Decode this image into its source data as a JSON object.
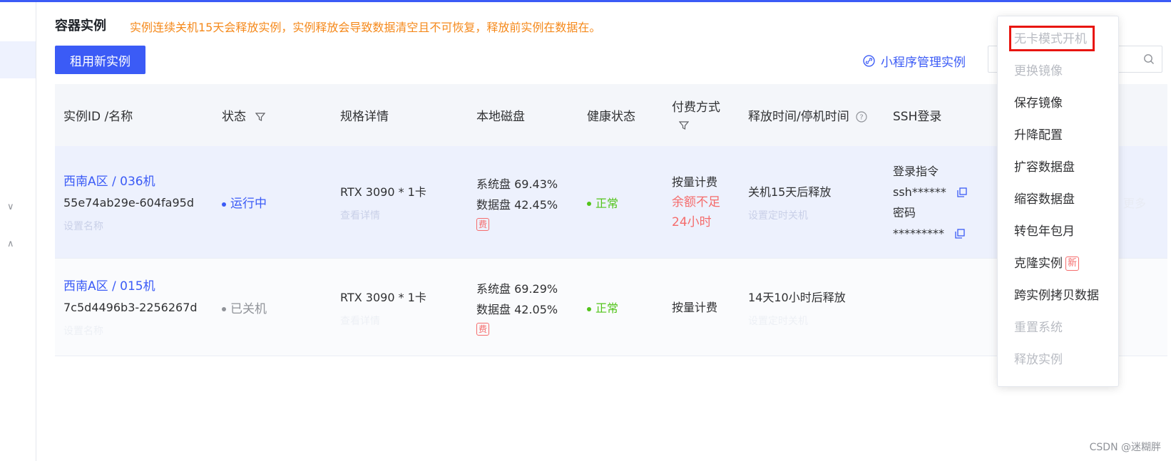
{
  "header": {
    "title": "容器实例",
    "notice": "实例连续关机15天会释放实例，实例释放会导致数据清空且不可恢复，释放前实例在数据在。",
    "rent_button": "租用新实例",
    "mini_program_link": "小程序管理实例",
    "search_placeholder": ""
  },
  "table": {
    "columns": [
      "实例ID /名称",
      "状态",
      "规格详情",
      "本地磁盘",
      "健康状态",
      "付费方式",
      "释放时间/停机时间",
      "SSH登录"
    ],
    "rows": [
      {
        "zone": "西南A区 / 036机",
        "instance_id": "55e74ab29e-604fa95d",
        "set_name": "设置名称",
        "status": "运行中",
        "spec": "RTX 3090 * 1卡",
        "spec_detail": "查看详情",
        "disk_system": "系统盘 69.43%",
        "disk_data": "数据盘 42.45%",
        "fee_badge": "费",
        "health": "正常",
        "billing": "按量计费",
        "billing_warning": "余额不足24小时",
        "release": "关机15天后释放",
        "release_action": "设置定时关机",
        "ssh_cmd_label": "登录指令",
        "ssh_cmd": "ssh******",
        "ssh_pwd_label": "密码",
        "ssh_pwd": "*********",
        "more": "更多"
      },
      {
        "zone": "西南A区 / 015机",
        "instance_id": "7c5d4496b3-2256267d",
        "set_name": "设置名称",
        "status": "已关机",
        "spec": "RTX 3090 * 1卡",
        "spec_detail": "查看详情",
        "disk_system": "系统盘 69.29%",
        "disk_data": "数据盘 42.05%",
        "fee_badge": "费",
        "health": "正常",
        "billing": "按量计费",
        "release": "14天10小时后释放",
        "release_action": "设置定时关机"
      }
    ]
  },
  "dropdown": {
    "items": [
      {
        "label": "无卡模式开机",
        "disabled": true
      },
      {
        "label": "更换镜像",
        "disabled": true
      },
      {
        "label": "保存镜像",
        "disabled": false
      },
      {
        "label": "升降配置",
        "disabled": false
      },
      {
        "label": "扩容数据盘",
        "disabled": false
      },
      {
        "label": "缩容数据盘",
        "disabled": false
      },
      {
        "label": "转包年包月",
        "disabled": false
      },
      {
        "label": "克隆实例",
        "disabled": false,
        "badge": "新"
      },
      {
        "label": "跨实例拷贝数据",
        "disabled": false
      },
      {
        "label": "重置系统",
        "disabled": true
      },
      {
        "label": "释放实例",
        "disabled": true
      }
    ]
  },
  "colors": {
    "accent": "#3b5bf6",
    "warning": "#f5891b",
    "danger": "#f56c6c",
    "success": "#52c41a",
    "highlight_box": "#e8150f"
  },
  "watermark": "CSDN @迷糊胖"
}
